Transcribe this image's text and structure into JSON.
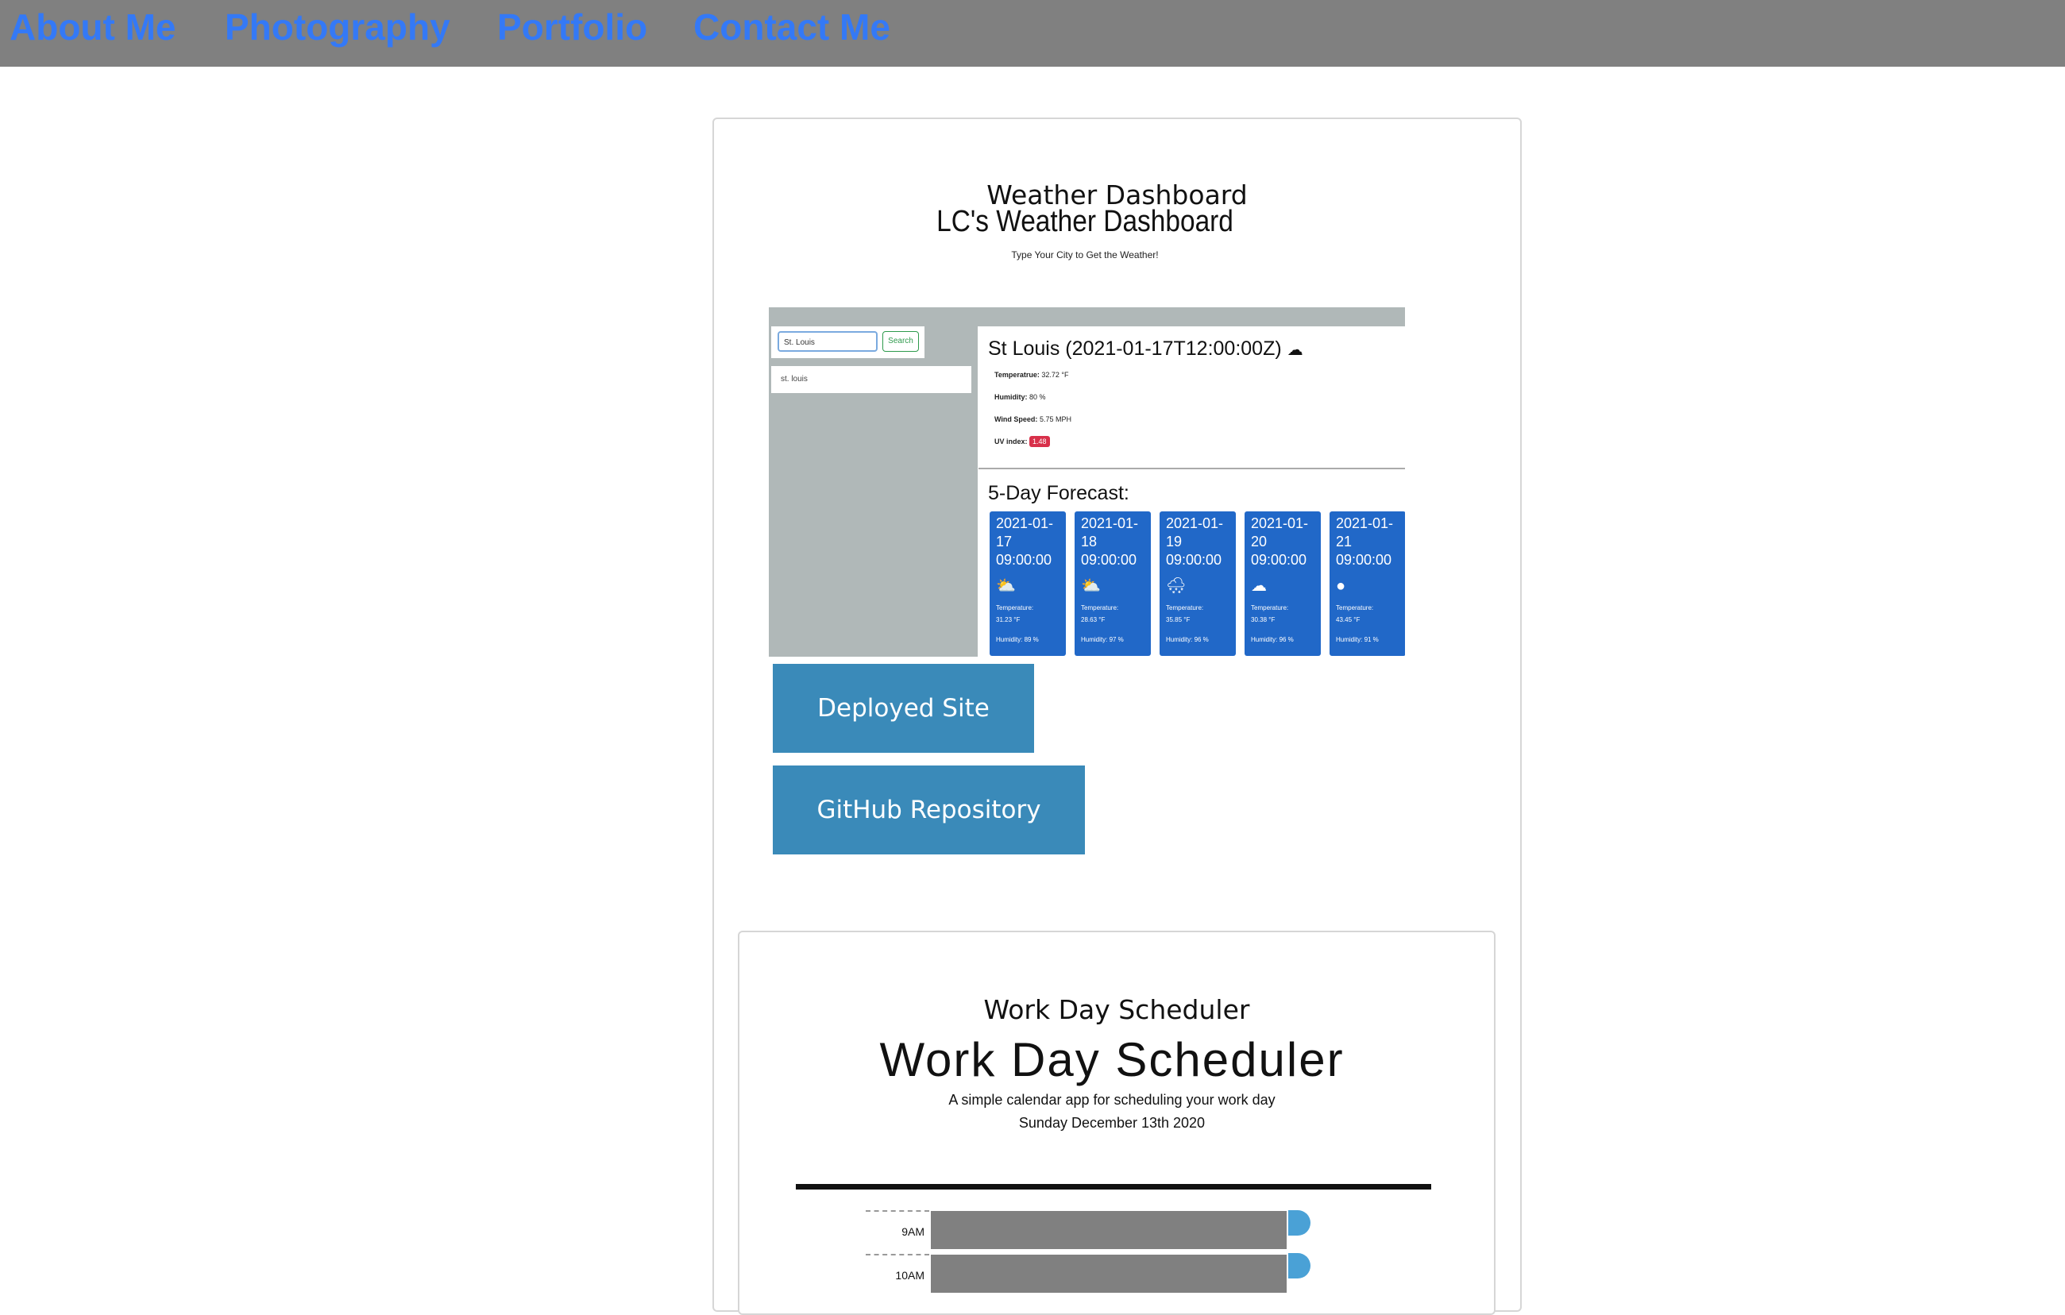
{
  "nav": {
    "items": [
      "About Me",
      "Photography",
      "Portfolio",
      "Contact Me"
    ],
    "link_color": "#3479f6",
    "bar_color": "#808080"
  },
  "projects": [
    {
      "card_title": "Weather Dashboard",
      "screenshot": {
        "heading": "LC's Weather Dashboard",
        "tagline": "Type Your City to Get the Weather!",
        "search_value": "St. Louis",
        "search_button": "Search",
        "history": [
          "st. louis"
        ],
        "current": {
          "city_line": "St Louis (2021-01-17T12:00:00Z)",
          "icon": "cloud-wind-icon",
          "temperature_label": "Temperatrue:",
          "temperature_value": "32.72 °F",
          "humidity_label": "Humidity:",
          "humidity_value": "80 %",
          "wind_label": "Wind Speed:",
          "wind_value": "5.75 MPH",
          "uv_label": "UV index:",
          "uv_value": "1.48",
          "uv_color": "#d8304a"
        },
        "forecast_title": "5-Day Forecast:",
        "forecast": [
          {
            "date": "2021-01-17 09:00:00",
            "icon": "partly-cloudy-icon",
            "temp_label": "Temperature:",
            "temp": "31.23 °F",
            "humidity": "Humidity: 89 %"
          },
          {
            "date": "2021-01-18 09:00:00",
            "icon": "partly-cloudy-icon",
            "temp_label": "Temperature:",
            "temp": "28.63 °F",
            "humidity": "Humidity: 97 %"
          },
          {
            "date": "2021-01-19 09:00:00",
            "icon": "snow-cloud-icon",
            "temp_label": "Temperature:",
            "temp": "35.85 °F",
            "humidity": "Humidity: 96 %"
          },
          {
            "date": "2021-01-20 09:00:00",
            "icon": "cloud-icon",
            "temp_label": "Temperature:",
            "temp": "30.38 °F",
            "humidity": "Humidity: 96 %"
          },
          {
            "date": "2021-01-21 09:00:00",
            "icon": "rain-cloud-icon",
            "temp_label": "Temperature:",
            "temp": "43.45 °F",
            "humidity": "Humidity: 91 %"
          }
        ],
        "forecast_color": "#2168c8"
      },
      "buttons": [
        "Deployed Site",
        "GitHub Repository"
      ],
      "button_color": "#3a8ab9"
    },
    {
      "card_title": "Work Day Scheduler",
      "screenshot": {
        "heading": "Work Day Scheduler",
        "tagline": "A simple calendar app for scheduling your work day",
        "date": "Sunday December 13th 2020",
        "hours": [
          "9AM",
          "10AM"
        ]
      }
    }
  ]
}
